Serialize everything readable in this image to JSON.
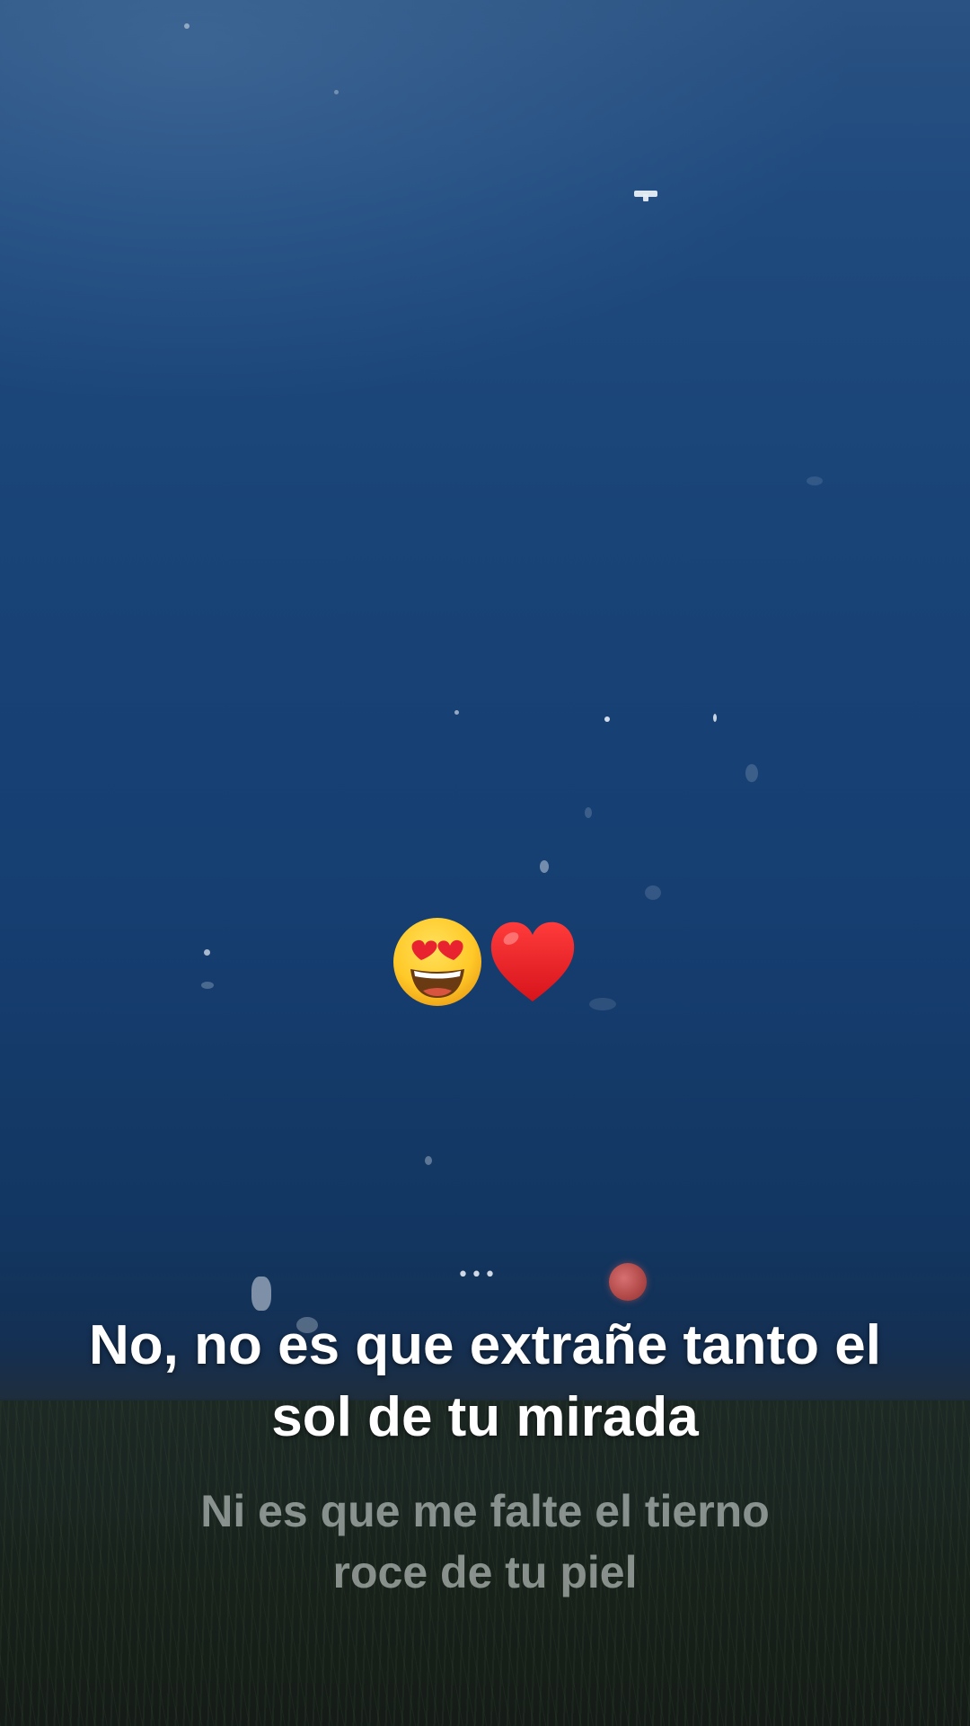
{
  "screen": {
    "background": "night-sky-with-field",
    "moon_color": "#b84c4c"
  },
  "sticker": {
    "emojis": [
      "😍",
      "❤️"
    ],
    "icon_names": [
      "heart-eyes-face-icon",
      "red-heart-icon"
    ]
  },
  "indicator": {
    "text": "•••"
  },
  "lyrics": {
    "current_line1": "No, no es que extrañe tanto el",
    "current_line2": "sol de tu mirada",
    "next_line1": "Ni es que me falte el tierno",
    "next_line2": "roce de tu piel"
  }
}
